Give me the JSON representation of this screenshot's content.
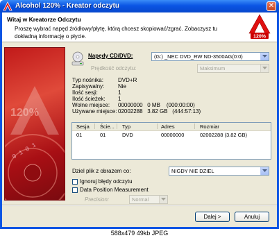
{
  "window": {
    "title": "Alcohol 120% - Kreator odczytu"
  },
  "header": {
    "title": "Witaj w Kreatorze Odczytu",
    "description": "Proszę wybrać napęd źródłowy/płytę, którą chcesz skopiować/zgrać. Zobaczysz tu dokładną informację o płycie.",
    "logo_text": "120%"
  },
  "banner": {
    "logo_text": "120%",
    "binary_text": "0 1 0 1"
  },
  "drive": {
    "label": "Napędy CD/DVD:",
    "value": "(G:) _NEC DVD_RW ND-3500AG(0:0)"
  },
  "speed": {
    "label": "Prędkość odczytu:",
    "value": "Maksimum"
  },
  "info": [
    {
      "label": "Typ nośnika:",
      "value": "DVD+R"
    },
    {
      "label": "Zapisywalny:",
      "value": "Nie"
    },
    {
      "label": "Ilość sesji:",
      "value": "1"
    },
    {
      "label": "Ilość ścieżek:",
      "value": "1"
    },
    {
      "label": "Wolne miejsce:",
      "value": "00000000   0 MB    (000:00:00)"
    },
    {
      "label": "Używane miejsce:",
      "value": "02002288   3.82 GB   (444:57:13)"
    }
  ],
  "tracks": {
    "columns": [
      "Sesja",
      "Ście...",
      "Typ",
      "Adres",
      "Rozmiar"
    ],
    "rows": [
      [
        "01",
        "01",
        "DVD",
        "00000000",
        "02002288 (3.82 GB)"
      ]
    ]
  },
  "split": {
    "label": "Dziel plik z obrazem co:",
    "value": "NIGDY NIE DZIEL"
  },
  "options": {
    "ignore_errors": "Ignoruj błędy odczytu",
    "dpm": "Data Position Measurement",
    "precision_label": "Precision:",
    "precision_value": "Normal"
  },
  "buttons": {
    "next": "Dalej >",
    "cancel": "Anuluj"
  },
  "image_caption": "588x479  49kb  JPEG",
  "colors": {
    "titlebar": "#0a55e4",
    "banner": "#c11a1a",
    "dialog": "#ece9d8"
  }
}
